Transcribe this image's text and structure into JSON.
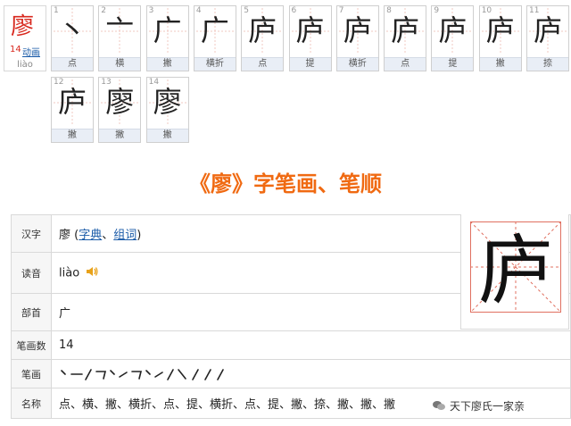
{
  "header_card": {
    "character": "廖",
    "stroke_count": "14",
    "animation_link": "动画",
    "pinyin": "liào"
  },
  "steps": [
    {
      "num": "1",
      "label": "点",
      "glyph": "丶"
    },
    {
      "num": "2",
      "label": "横",
      "glyph": "亠"
    },
    {
      "num": "3",
      "label": "撇",
      "glyph": "广"
    },
    {
      "num": "4",
      "label": "横折",
      "glyph": "广"
    },
    {
      "num": "5",
      "label": "点",
      "glyph": "庐"
    },
    {
      "num": "6",
      "label": "提",
      "glyph": "庐"
    },
    {
      "num": "7",
      "label": "横折",
      "glyph": "庐"
    },
    {
      "num": "8",
      "label": "点",
      "glyph": "庐"
    },
    {
      "num": "9",
      "label": "提",
      "glyph": "庐"
    },
    {
      "num": "10",
      "label": "撇",
      "glyph": "庐"
    },
    {
      "num": "11",
      "label": "捺",
      "glyph": "庐"
    },
    {
      "num": "12",
      "label": "撇",
      "glyph": "庐"
    },
    {
      "num": "13",
      "label": "撇",
      "glyph": "廖"
    },
    {
      "num": "14",
      "label": "撇",
      "glyph": "廖"
    }
  ],
  "section_title": "《廖》字笔画、笔顺",
  "table": {
    "char_label": "汉字",
    "char_value": "廖",
    "link_open": "(",
    "link_dict": "字典",
    "link_sep": "、",
    "link_words": "组词",
    "link_close": ")",
    "reading_label": "读音",
    "reading_value": "liào",
    "radical_label": "部首",
    "radical_value": "广",
    "count_label": "笔画数",
    "count_value": "14",
    "strokes_label": "笔画",
    "names_label": "名称",
    "names_value": "点、横、撇、横折、点、提、横折、点、提、撇、捺、撇、撇、撇"
  },
  "big_glyph": "庐",
  "watermark": {
    "text": "天下廖氏一家亲"
  },
  "colors": {
    "title": "#f06a12",
    "red": "#d8281e",
    "link": "#1a5ba8"
  }
}
